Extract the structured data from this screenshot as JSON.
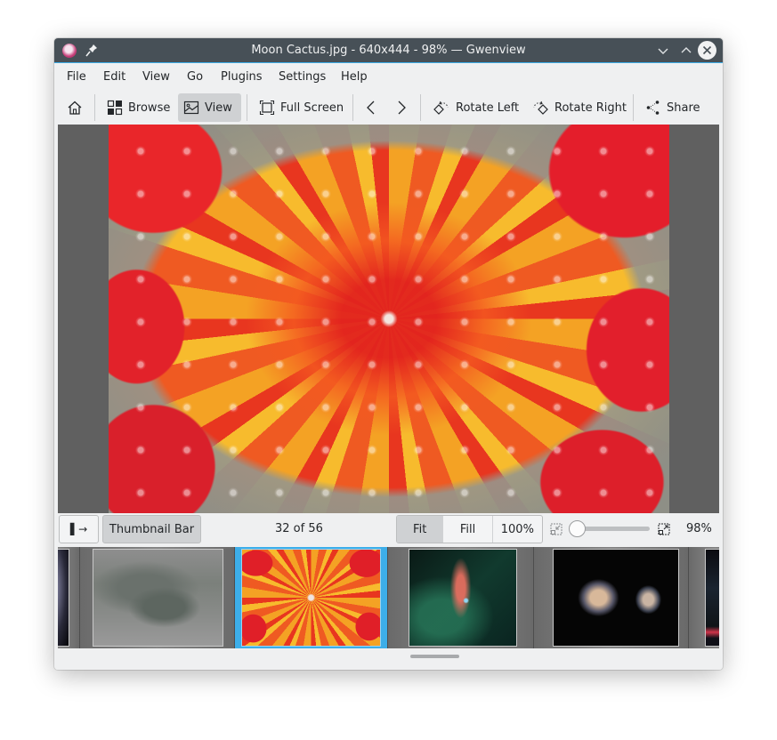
{
  "window": {
    "title": "Moon Cactus.jpg - 640x444 - 98% — Gwenview",
    "icons": {
      "app": "gwenview-app-icon",
      "pin": "pin-icon",
      "minimize": "chevron-down-icon",
      "maximize": "chevron-up-icon",
      "close": "close-icon"
    }
  },
  "menubar": {
    "items": [
      "File",
      "Edit",
      "View",
      "Go",
      "Plugins",
      "Settings",
      "Help"
    ]
  },
  "toolbar": {
    "home_icon": "home-icon",
    "browse_label": "Browse",
    "view_label": "View",
    "fullscreen_label": "Full Screen",
    "previous_icon": "chevron-left-icon",
    "next_icon": "chevron-right-icon",
    "rotate_left_label": "Rotate Left",
    "rotate_right_label": "Rotate Right",
    "share_label": "Share",
    "active_mode": "View"
  },
  "image": {
    "name": "Moon Cactus.jpg",
    "dimensions": "640x444"
  },
  "statusbar": {
    "sidebar_toggle_glyph": "▌→",
    "thumbnail_bar_label": "Thumbnail Bar",
    "thumbnail_bar_checked": true,
    "counter": "32 of 56",
    "zoom_modes": [
      {
        "label": "Fit",
        "checked": true
      },
      {
        "label": "Fill",
        "checked": false
      },
      {
        "label": "100%",
        "checked": false
      }
    ],
    "zoom_out_icon": "zoom-out-icon",
    "zoom_in_icon": "zoom-in-icon",
    "zoom_level": "98%",
    "zoom_slider_position": 0.05
  },
  "thumbnails": [
    {
      "subject": "galaxy (partial)",
      "selected": false
    },
    {
      "subject": "misty forest",
      "selected": false
    },
    {
      "subject": "moon cactus",
      "selected": true
    },
    {
      "subject": "nebula bow shock",
      "selected": false
    },
    {
      "subject": "interacting galaxies",
      "selected": false
    },
    {
      "subject": "space image (partial)",
      "selected": false
    }
  ],
  "colors": {
    "titlebar": "#475057",
    "accent": "#3daee9",
    "window_bg": "#eff0f1",
    "viewer_bg": "#606060",
    "checked_button": "#cfd1d3"
  }
}
